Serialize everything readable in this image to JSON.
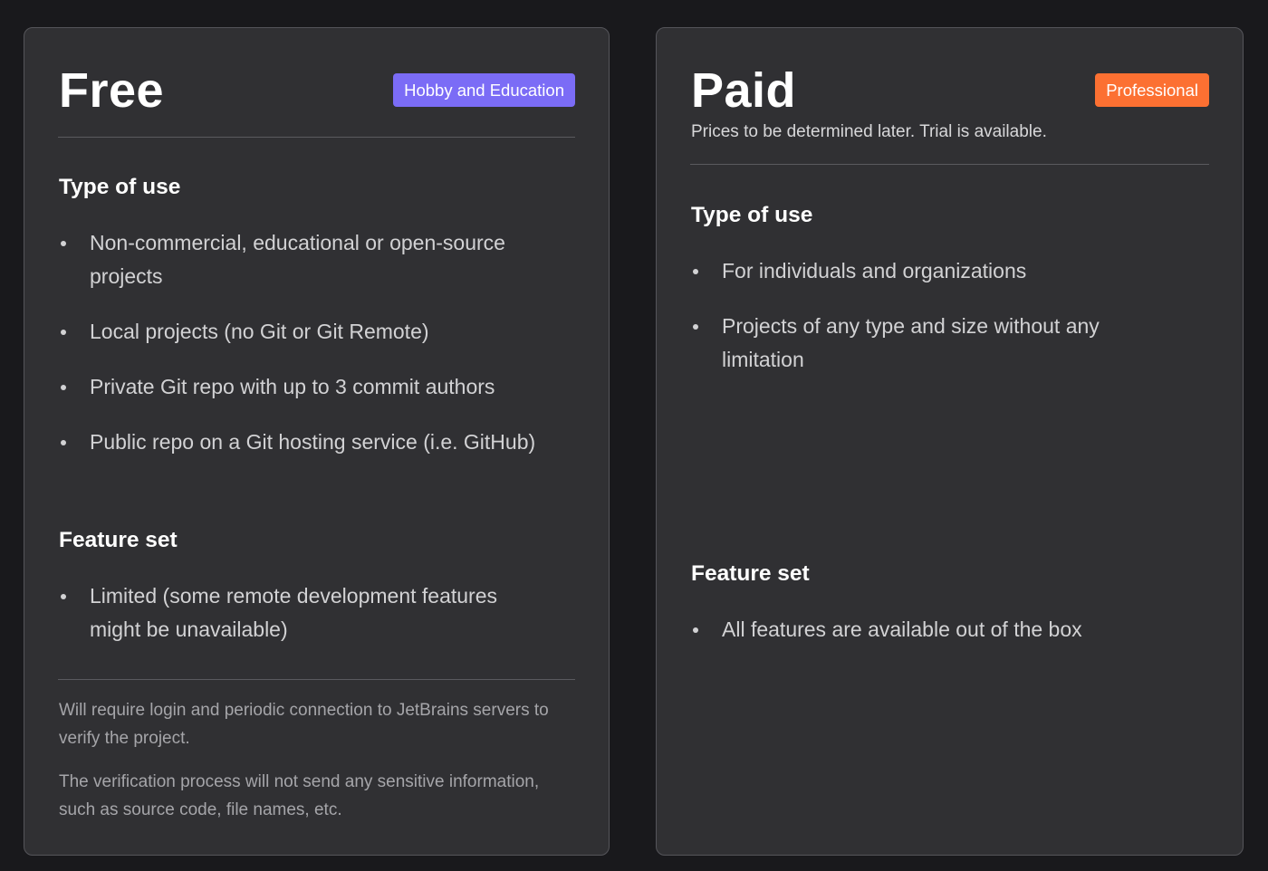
{
  "plans": {
    "free": {
      "title": "Free",
      "badge": {
        "label": "Hobby and Education",
        "color": "#7b6cf6"
      },
      "type_of_use": {
        "heading": "Type of use",
        "items": [
          "Non-commercial, educational or open-source projects",
          "Local projects (no Git or Git Remote)",
          "Private Git repo with up to 3 commit authors",
          "Public repo on a Git hosting service (i.e. GitHub)"
        ]
      },
      "feature_set": {
        "heading": "Feature set",
        "items": [
          "Limited (some remote development features might be unavailable)"
        ]
      },
      "notes": [
        "Will require login and periodic connection to JetBrains servers to verify the project.",
        "The verification process will not send any sensitive information, such as source code, file names, etc."
      ]
    },
    "paid": {
      "title": "Paid",
      "badge": {
        "label": "Professional",
        "color": "#fc7032"
      },
      "subtitle": "Prices to be determined later. Trial is available.",
      "type_of_use": {
        "heading": "Type of use",
        "items": [
          "For individuals and organizations",
          "Projects of any type and size without any limitation"
        ]
      },
      "feature_set": {
        "heading": "Feature set",
        "items": [
          "All features are available out of the box"
        ]
      }
    }
  },
  "colors": {
    "background": "#19191c",
    "card": "#303033",
    "card_border": "#55555a",
    "text_primary": "#ffffff",
    "text_secondary": "#d2d2d4",
    "text_muted": "#a5a5a9"
  }
}
